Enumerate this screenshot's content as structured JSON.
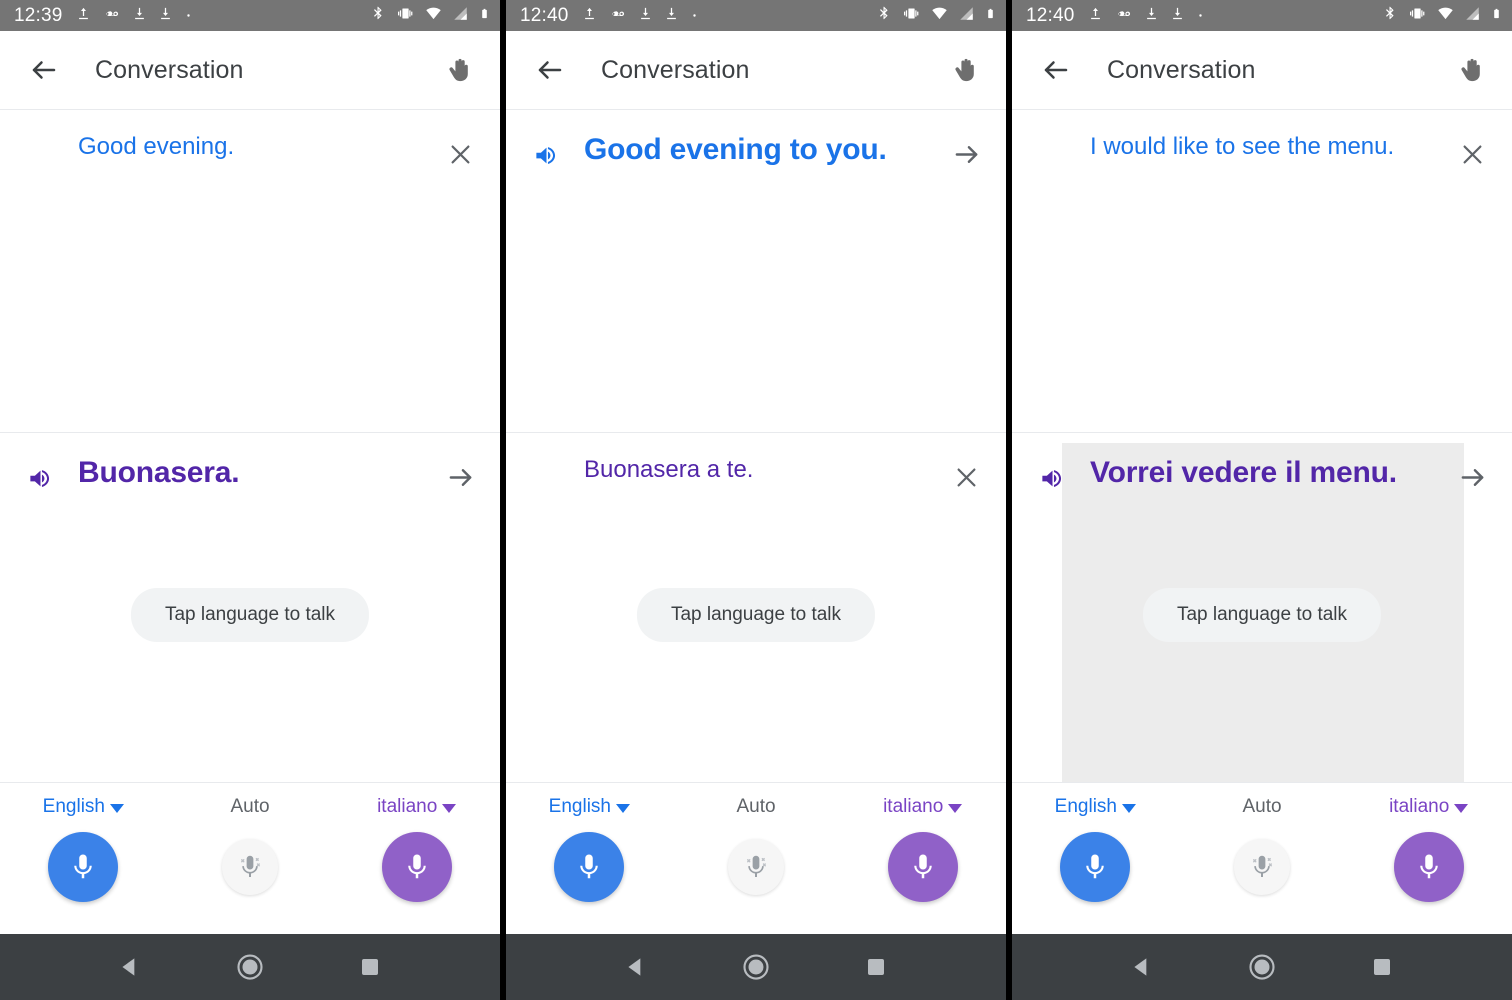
{
  "app": {
    "title": "Conversation",
    "back_icon": "arrow-back-icon",
    "pause_icon": "hand-pause-icon"
  },
  "colors": {
    "source_blue": "#1a73e8",
    "target_purple": "#5226a8",
    "mic_blue": "#3b82e8",
    "mic_purple": "#9061c8",
    "statusbar_grey": "#757575",
    "navbar_grey": "#3c4043",
    "highlight_grey": "#ececec",
    "tooltip_grey": "#f1f3f4"
  },
  "panels": [
    {
      "status": {
        "time": "12:39",
        "left_icons": [
          "upload-icon",
          "voicemail-icon",
          "download-icon",
          "download-icon",
          "dot-icon"
        ],
        "right_icons": [
          "bluetooth-icon",
          "vibrate-icon",
          "wifi-icon",
          "signal-icon",
          "battery-icon"
        ]
      },
      "top_message": {
        "text": "Good evening.",
        "language": "en",
        "emphasis": "plain",
        "has_speaker": false,
        "action": "close",
        "highlighted": false
      },
      "bottom_message": {
        "text": "Buonasera.",
        "language": "it",
        "emphasis": "strong",
        "has_speaker": true,
        "action": "forward",
        "highlighted": false
      },
      "tooltip": "Tap language to talk",
      "languages": {
        "source": "English",
        "auto": "Auto",
        "target": "italiano"
      }
    },
    {
      "status": {
        "time": "12:40",
        "left_icons": [
          "upload-icon",
          "voicemail-icon",
          "download-icon",
          "download-icon",
          "dot-icon"
        ],
        "right_icons": [
          "bluetooth-icon",
          "vibrate-icon",
          "wifi-icon",
          "signal-icon",
          "battery-icon"
        ]
      },
      "top_message": {
        "text": "Good evening to you.",
        "language": "en",
        "emphasis": "strong",
        "has_speaker": true,
        "action": "forward",
        "highlighted": false
      },
      "bottom_message": {
        "text": "Buonasera a te.",
        "language": "it",
        "emphasis": "plain",
        "has_speaker": false,
        "action": "close",
        "highlighted": false
      },
      "tooltip": "Tap language to talk",
      "languages": {
        "source": "English",
        "auto": "Auto",
        "target": "italiano"
      }
    },
    {
      "status": {
        "time": "12:40",
        "left_icons": [
          "upload-icon",
          "voicemail-icon",
          "download-icon",
          "download-icon",
          "dot-icon"
        ],
        "right_icons": [
          "bluetooth-icon",
          "vibrate-icon",
          "wifi-icon",
          "signal-icon",
          "battery-icon"
        ]
      },
      "top_message": {
        "text": "I would like to see the menu.",
        "language": "en",
        "emphasis": "plain",
        "has_speaker": false,
        "action": "close",
        "highlighted": false
      },
      "bottom_message": {
        "text": "Vorrei vedere il menu.",
        "language": "it",
        "emphasis": "strong",
        "has_speaker": true,
        "action": "forward",
        "highlighted": true
      },
      "tooltip": "Tap language to talk",
      "languages": {
        "source": "English",
        "auto": "Auto",
        "target": "italiano"
      }
    }
  ],
  "navbar": {
    "back": "triangle-back-icon",
    "home": "circle-home-icon",
    "recents": "square-recents-icon"
  }
}
